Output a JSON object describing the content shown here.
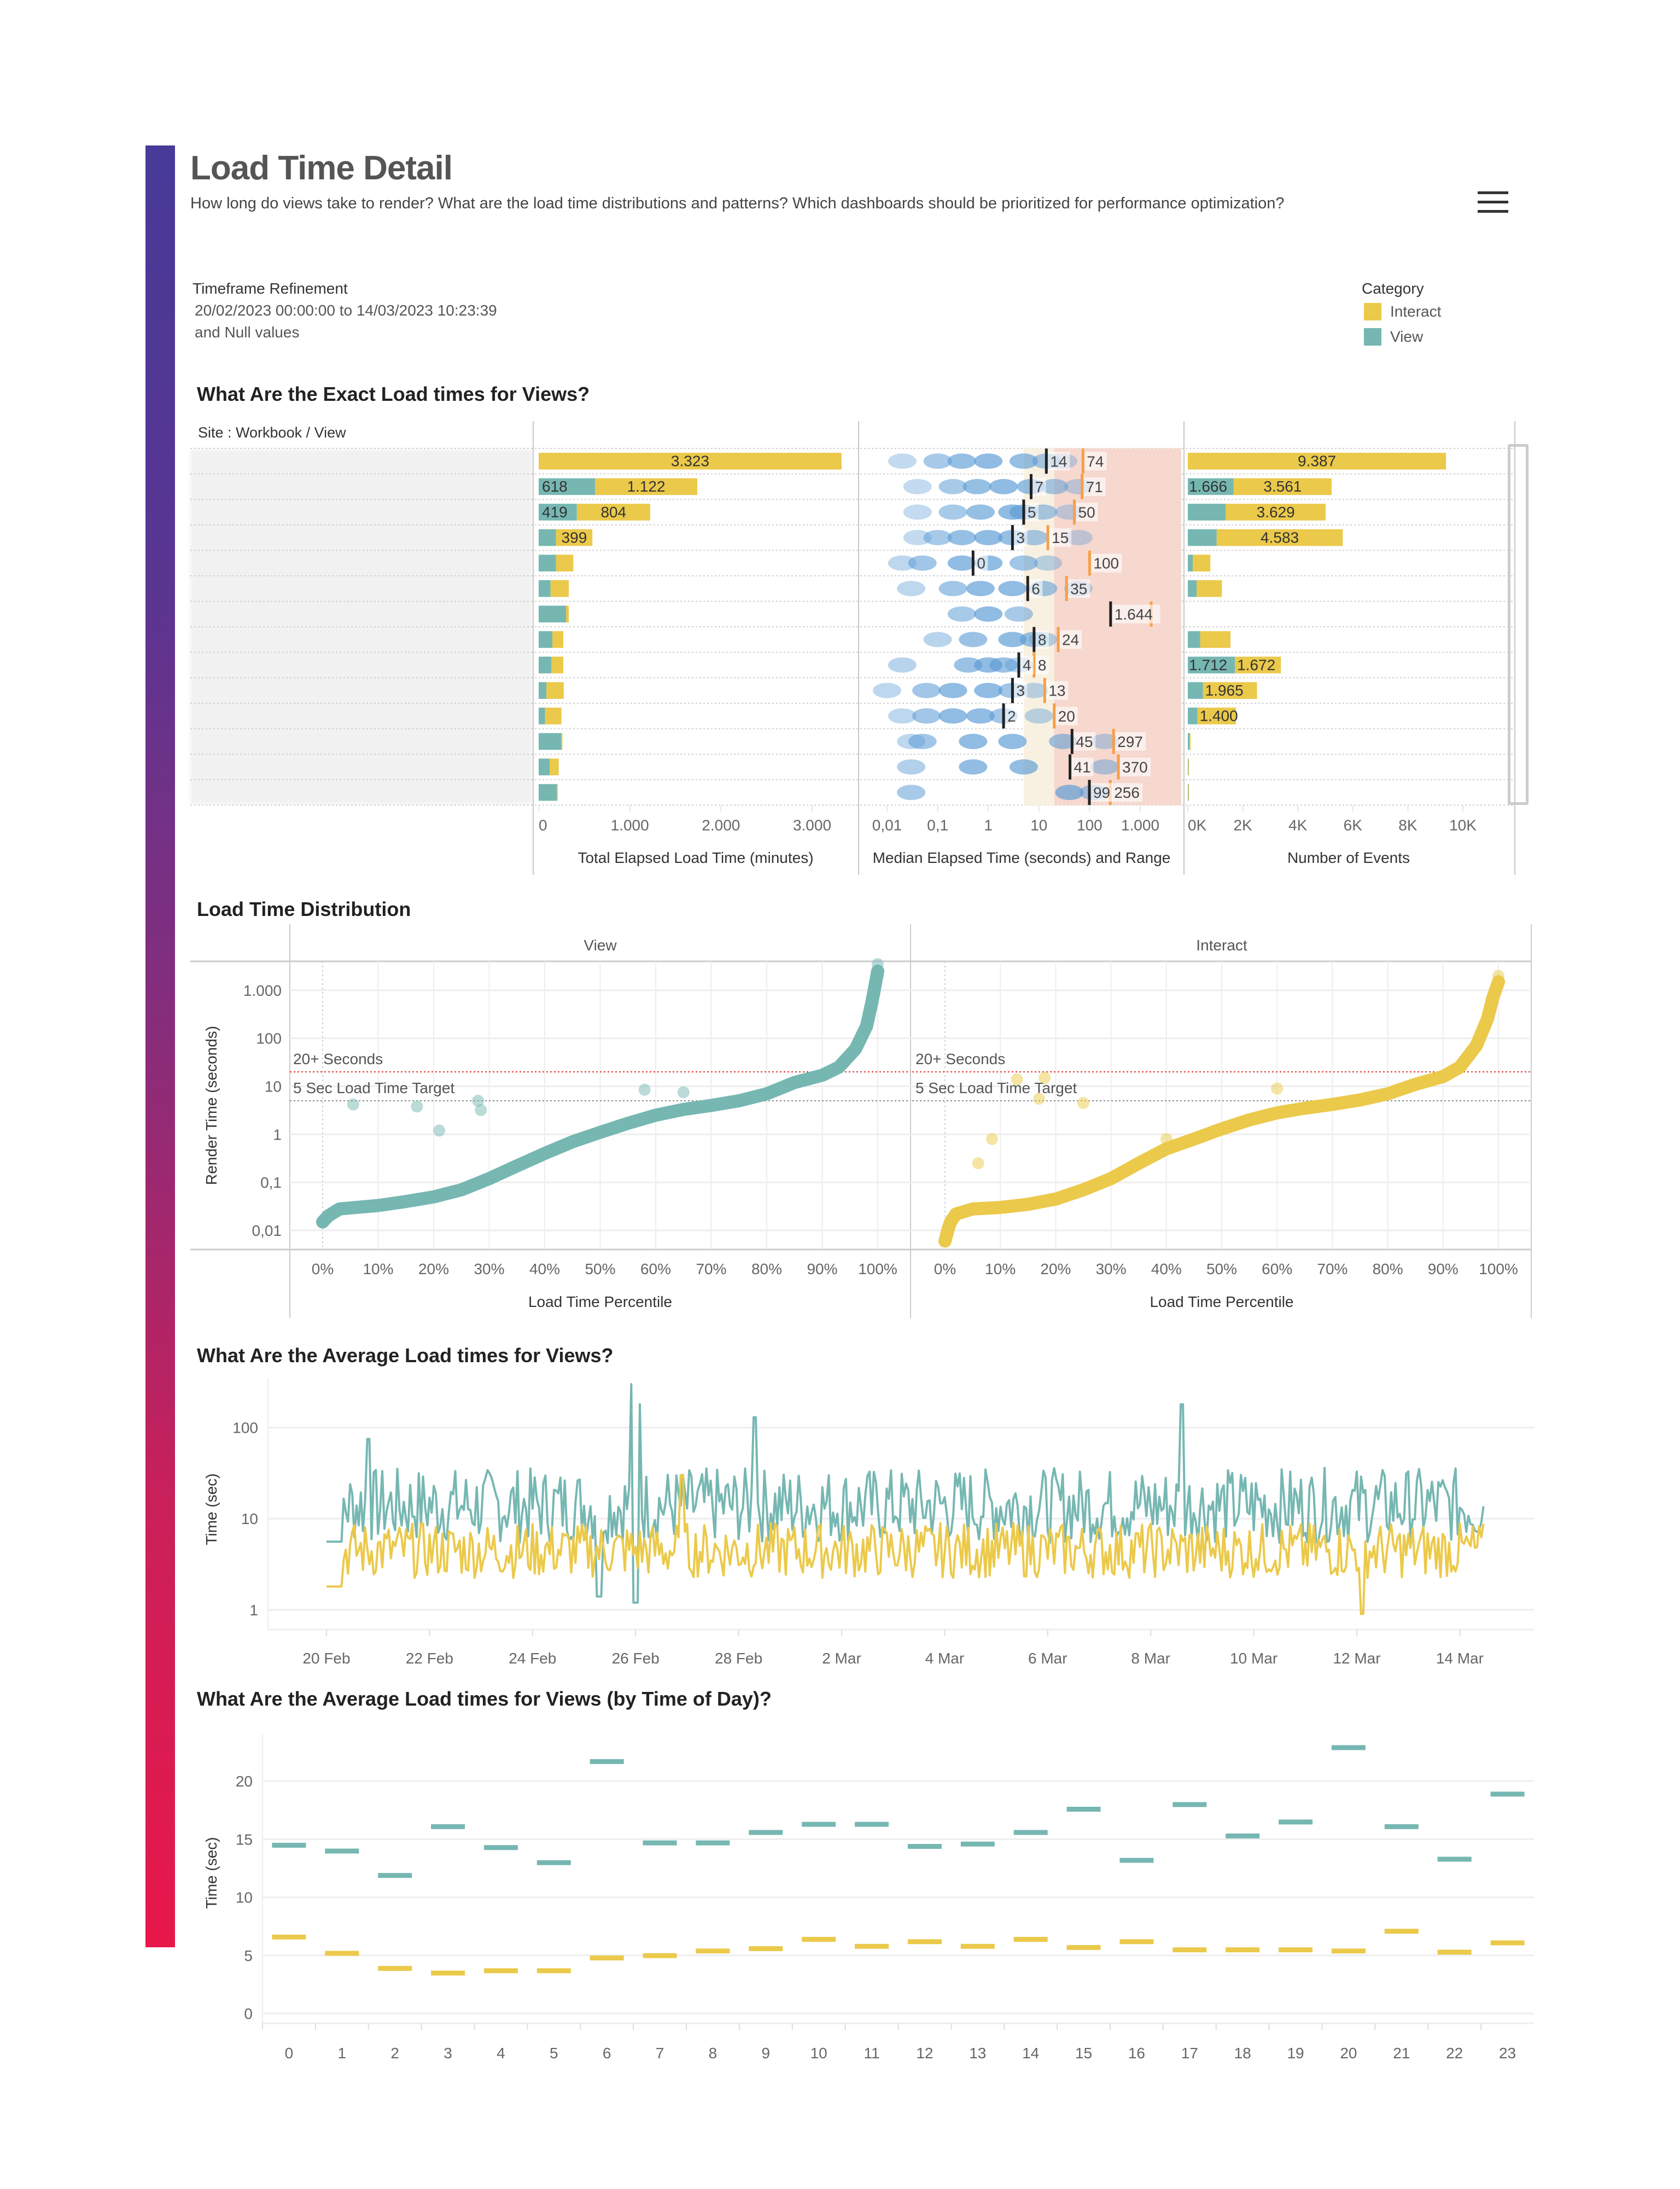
{
  "header": {
    "title": "Load Time Detail",
    "subtitle": "How long do views take to render? What are the load time distributions and patterns?  Which dashboards should be prioritized for performance optimization?",
    "menu_icon": "hamburger-menu-icon"
  },
  "filter": {
    "label": "Timeframe Refinement",
    "range": "20/02/2023 00:00:00 to 14/03/2023 10:23:39",
    "null_note": "and Null values"
  },
  "legend": {
    "title": "Category",
    "items": [
      {
        "label": "Interact",
        "color": "#ebc94a"
      },
      {
        "label": "View",
        "color": "#76b7b2"
      }
    ]
  },
  "colors": {
    "view": "#76b7b2",
    "interact": "#ebc94a",
    "target_line": "#888888",
    "threshold_line": "#e03030",
    "median_tick": "#222222",
    "range_tick": "#f5a04a",
    "band_5_20": "#f8f1e2",
    "band_20_plus": "#f6d8cf"
  },
  "section_exact": {
    "title": "What Are the Exact Load times for Views?",
    "row_header": "Site : Workbook / View",
    "rows_redacted": true
  },
  "section_distribution": {
    "title": "Load Time Distribution"
  },
  "section_avg": {
    "title": "What Are the Average Load times for Views?"
  },
  "section_tod": {
    "title": "What Are the Average Load times for Views (by Time of Day)?"
  },
  "chart_data": [
    {
      "id": "total-elapsed",
      "type": "bar",
      "stacked": true,
      "orientation": "horizontal",
      "xlabel": "Total Elapsed Load Time (minutes)",
      "xlim": [
        0,
        3300
      ],
      "xticks": [
        "0",
        "1.000",
        "2.000",
        "3.000"
      ],
      "xtick_values": [
        0,
        1000,
        2000,
        3000
      ],
      "series": [
        {
          "name": "View",
          "values": [
            0,
            618,
            419,
            190,
            190,
            130,
            300,
            150,
            140,
            85,
            70,
            250,
            120,
            200
          ],
          "labels": [
            "",
            "618",
            "419",
            "",
            "",
            "",
            "",
            "",
            "",
            "",
            "",
            "",
            "",
            ""
          ]
        },
        {
          "name": "Interact",
          "values": [
            3323,
            1122,
            804,
            399,
            190,
            200,
            30,
            120,
            130,
            190,
            180,
            10,
            100,
            10
          ],
          "labels": [
            "3.323",
            "1.122",
            "804",
            "399",
            "",
            "",
            "",
            "",
            "",
            "",
            "",
            "",
            "",
            ""
          ]
        }
      ]
    },
    {
      "id": "median-range",
      "type": "scatter",
      "xscale": "log",
      "xlabel": "Median Elapsed Time (seconds) and Range",
      "xlim": [
        0.005,
        2500
      ],
      "xticks": [
        "0,01",
        "0,1",
        "1",
        "10",
        "100",
        "1.000"
      ],
      "xtick_values": [
        0.01,
        0.1,
        1,
        10,
        100,
        1000
      ],
      "bands": [
        {
          "from": 5,
          "to": 20,
          "label": "5-20 sec"
        },
        {
          "from": 20,
          "to": 2500,
          "label": "20+ sec"
        }
      ],
      "rows": [
        {
          "median": 14,
          "upper": 74,
          "median_label": "14",
          "upper_label": "74",
          "density": [
            0.02,
            0.1,
            0.3,
            1,
            5,
            14,
            30
          ]
        },
        {
          "median": 7,
          "upper": 71,
          "median_label": "7",
          "upper_label": "71",
          "density": [
            0.04,
            0.2,
            0.6,
            2,
            7,
            20,
            60
          ]
        },
        {
          "median": 5,
          "upper": 50,
          "median_label": "5",
          "upper_label": "50",
          "density": [
            0.04,
            0.2,
            0.7,
            3,
            5,
            12,
            40
          ]
        },
        {
          "median": 3,
          "upper": 15,
          "median_label": "3",
          "upper_label": "15",
          "density": [
            0.04,
            0.1,
            0.3,
            1,
            3,
            8,
            60
          ]
        },
        {
          "median": 0.5,
          "upper": 100,
          "median_label": "0",
          "upper_label": "100",
          "density": [
            0.02,
            0.05,
            0.3,
            1,
            5,
            15
          ]
        },
        {
          "median": 6,
          "upper": 35,
          "median_label": "6",
          "upper_label": "35",
          "density": [
            0.03,
            0.2,
            0.7,
            3,
            12,
            60
          ]
        },
        {
          "median": 260,
          "upper": 1644,
          "median_label": "1.644",
          "upper_label": "",
          "density": [
            0.3,
            1,
            4
          ]
        },
        {
          "median": 8,
          "upper": 24,
          "median_label": "8",
          "upper_label": "24",
          "density": [
            0.1,
            0.5,
            3,
            8,
            12
          ]
        },
        {
          "median": 4,
          "upper": 8,
          "median_label": "4",
          "upper_label": "8",
          "density": [
            0.02,
            0.4,
            1,
            2,
            4
          ]
        },
        {
          "median": 3,
          "upper": 13,
          "median_label": "3",
          "upper_label": "13",
          "density": [
            0.01,
            0.06,
            0.2,
            1,
            3,
            8
          ]
        },
        {
          "median": 2,
          "upper": 20,
          "median_label": "2",
          "upper_label": "20",
          "density": [
            0.02,
            0.06,
            0.2,
            0.7,
            2,
            10
          ]
        },
        {
          "median": 45,
          "upper": 297,
          "median_label": "45",
          "upper_label": "297",
          "density": [
            0.03,
            0.05,
            0.5,
            3,
            30,
            200
          ]
        },
        {
          "median": 41,
          "upper": 370,
          "median_label": "41",
          "upper_label": "370",
          "density": [
            0.03,
            0.5,
            5,
            200
          ]
        },
        {
          "median": 99,
          "upper": 256,
          "median_label": "99",
          "upper_label": "256",
          "density": [
            0.03,
            40,
            120
          ]
        }
      ]
    },
    {
      "id": "number-of-events",
      "type": "bar",
      "stacked": true,
      "orientation": "horizontal",
      "xlabel": "Number of Events",
      "xlim": [
        0,
        11500
      ],
      "xticks": [
        "0K",
        "2K",
        "4K",
        "6K",
        "8K",
        "10K"
      ],
      "xtick_values": [
        0,
        2000,
        4000,
        6000,
        8000,
        10000
      ],
      "series": [
        {
          "name": "View",
          "values": [
            0,
            1666,
            1380,
            1050,
            180,
            320,
            0,
            450,
            1712,
            550,
            350,
            60,
            20,
            20
          ],
          "labels": [
            "",
            "1.666",
            "",
            "",
            "",
            "",
            "",
            "",
            "1.712",
            "",
            "",
            "",
            "",
            ""
          ]
        },
        {
          "name": "Interact",
          "values": [
            9387,
            3561,
            3629,
            4583,
            640,
            920,
            0,
            1100,
            1672,
            1965,
            1400,
            40,
            20,
            20
          ],
          "labels": [
            "9.387",
            "3.561",
            "3.629",
            "4.583",
            "",
            "",
            "",
            "",
            "1.672",
            "1.965",
            "1.400",
            "",
            "",
            ""
          ]
        }
      ]
    },
    {
      "id": "load-time-distribution",
      "type": "scatter",
      "yscale": "log",
      "ylabel": "Render Time (seconds)",
      "xlabel": "Load Time Percentile",
      "ylim": [
        0.004,
        4000
      ],
      "yticks": [
        "0,01",
        "0,1",
        "1",
        "10",
        "100",
        "1.000"
      ],
      "ytick_values": [
        0.01,
        0.1,
        1,
        10,
        100,
        1000
      ],
      "xticks": [
        "0%",
        "10%",
        "20%",
        "30%",
        "40%",
        "50%",
        "60%",
        "70%",
        "80%",
        "90%",
        "100%"
      ],
      "reference_lines": [
        {
          "label": "20+ Seconds",
          "value": 20,
          "style": "red-dotted"
        },
        {
          "label": "5 Sec Load Time Target",
          "value": 5,
          "style": "gray-dotted"
        }
      ],
      "panels": [
        {
          "name": "View",
          "curve": [
            [
              0,
              0.015
            ],
            [
              1,
              0.02
            ],
            [
              3,
              0.028
            ],
            [
              6,
              0.03
            ],
            [
              10,
              0.033
            ],
            [
              15,
              0.04
            ],
            [
              20,
              0.05
            ],
            [
              25,
              0.07
            ],
            [
              30,
              0.12
            ],
            [
              35,
              0.22
            ],
            [
              40,
              0.4
            ],
            [
              45,
              0.7
            ],
            [
              50,
              1.1
            ],
            [
              55,
              1.7
            ],
            [
              60,
              2.5
            ],
            [
              65,
              3.3
            ],
            [
              70,
              4
            ],
            [
              75,
              5
            ],
            [
              80,
              7
            ],
            [
              85,
              12
            ],
            [
              90,
              17
            ],
            [
              93,
              25
            ],
            [
              96,
              60
            ],
            [
              98,
              180
            ],
            [
              99,
              600
            ],
            [
              100,
              2500
            ]
          ],
          "outliers": [
            [
              5.5,
              4.2
            ],
            [
              17,
              3.8
            ],
            [
              21,
              1.2
            ],
            [
              28,
              5
            ],
            [
              28.5,
              3.2
            ],
            [
              58,
              8.5
            ],
            [
              65,
              7.5
            ],
            [
              100,
              3500
            ]
          ]
        },
        {
          "name": "Interact",
          "curve": [
            [
              0,
              0.006
            ],
            [
              0.5,
              0.01
            ],
            [
              1,
              0.015
            ],
            [
              2,
              0.022
            ],
            [
              5,
              0.028
            ],
            [
              10,
              0.03
            ],
            [
              15,
              0.035
            ],
            [
              20,
              0.045
            ],
            [
              25,
              0.07
            ],
            [
              30,
              0.12
            ],
            [
              35,
              0.25
            ],
            [
              40,
              0.5
            ],
            [
              45,
              0.8
            ],
            [
              50,
              1.3
            ],
            [
              55,
              2
            ],
            [
              60,
              2.8
            ],
            [
              65,
              3.5
            ],
            [
              70,
              4.2
            ],
            [
              75,
              5.2
            ],
            [
              80,
              7
            ],
            [
              85,
              11
            ],
            [
              90,
              16
            ],
            [
              93,
              25
            ],
            [
              96,
              70
            ],
            [
              98,
              250
            ],
            [
              99,
              700
            ],
            [
              100,
              1500
            ]
          ],
          "outliers": [
            [
              6,
              0.25
            ],
            [
              8.5,
              0.8
            ],
            [
              13,
              14
            ],
            [
              17,
              5.5
            ],
            [
              18,
              15
            ],
            [
              25,
              4.5
            ],
            [
              40,
              0.8
            ],
            [
              60,
              9
            ],
            [
              100,
              2000
            ]
          ]
        }
      ]
    },
    {
      "id": "avg-load-over-time",
      "type": "line",
      "yscale": "log",
      "ylabel": "Time (sec)",
      "xlabel": "",
      "ylim": [
        0.8,
        350
      ],
      "yticks": [
        "1",
        "10",
        "100"
      ],
      "ytick_values": [
        1,
        10,
        100
      ],
      "xticks": [
        "20 Feb",
        "22 Feb",
        "24 Feb",
        "26 Feb",
        "28 Feb",
        "2 Mar",
        "4 Mar",
        "6 Mar",
        "8 Mar",
        "10 Mar",
        "12 Mar",
        "14 Mar"
      ],
      "xtick_days": [
        0,
        2,
        4,
        6,
        8,
        10,
        12,
        14,
        16,
        18,
        20,
        22
      ],
      "x_range_days": [
        -1.1,
        23.5
      ],
      "granularity": "hourly",
      "series": [
        {
          "name": "View",
          "color": "#76b7b2",
          "summary": "hourly averages mostly 5–30 sec, peaks ~300 sec near 26 Feb, troughs ~1.2 sec"
        },
        {
          "name": "Interact",
          "color": "#ebc94a",
          "summary": "hourly averages mostly 2–10 sec, occasional spikes to ~30 sec around 25–27 Feb and 12 Mar"
        }
      ]
    },
    {
      "id": "avg-load-by-hour",
      "type": "scatter",
      "mark": "dash",
      "ylabel": "Time (sec)",
      "xlabel": "",
      "ylim": [
        0,
        24
      ],
      "yticks": [
        "0",
        "5",
        "10",
        "15",
        "20"
      ],
      "ytick_values": [
        0,
        5,
        10,
        15,
        20
      ],
      "categories": [
        "0",
        "1",
        "2",
        "3",
        "4",
        "5",
        "6",
        "7",
        "8",
        "9",
        "10",
        "11",
        "12",
        "13",
        "14",
        "15",
        "16",
        "17",
        "18",
        "19",
        "20",
        "21",
        "22",
        "23"
      ],
      "series": [
        {
          "name": "View",
          "values": [
            14.5,
            14.0,
            11.9,
            16.1,
            14.3,
            13.0,
            21.7,
            14.7,
            14.7,
            15.6,
            16.3,
            16.3,
            14.4,
            14.6,
            15.6,
            17.6,
            13.2,
            18.0,
            15.3,
            16.5,
            22.9,
            16.1,
            13.3,
            18.9
          ]
        },
        {
          "name": "Interact",
          "values": [
            6.6,
            5.2,
            3.9,
            3.5,
            3.7,
            3.7,
            4.8,
            5.0,
            5.4,
            5.6,
            6.4,
            5.8,
            6.2,
            5.8,
            6.4,
            5.7,
            6.2,
            5.5,
            5.5,
            5.5,
            5.4,
            7.1,
            5.3,
            6.1
          ]
        }
      ]
    }
  ]
}
